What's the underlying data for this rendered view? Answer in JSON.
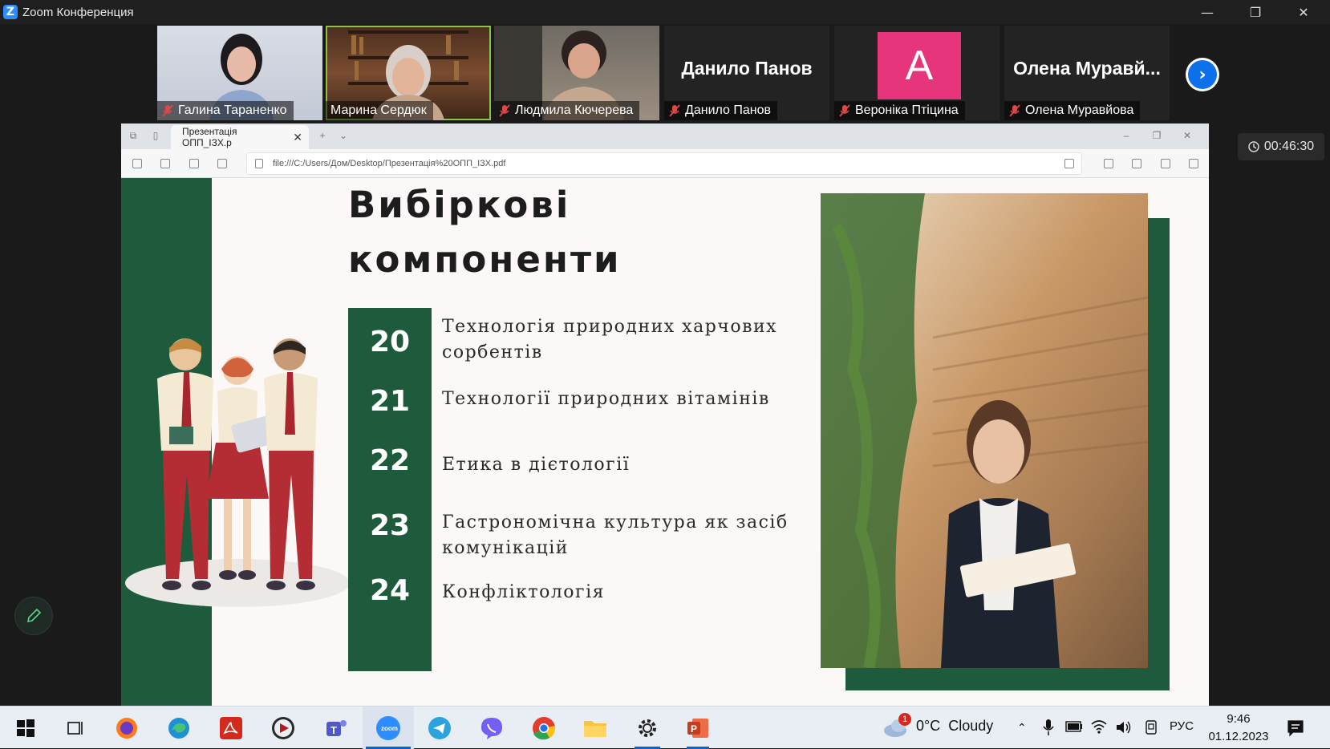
{
  "window": {
    "title": "Zoom Конференция",
    "controls": {
      "minimize": "—",
      "restore": "❐",
      "close": "✕"
    }
  },
  "participants": [
    {
      "name": "Галина Тараненко",
      "muted": true,
      "type": "video"
    },
    {
      "name": "Марина Сердюк",
      "muted": false,
      "type": "video",
      "active_speaker": true
    },
    {
      "name": "Людмила Кючерева",
      "muted": true,
      "type": "video"
    },
    {
      "name": "Данило Панов",
      "muted": true,
      "type": "name",
      "display": "Данило Панов"
    },
    {
      "name": "Вероніка Птіцина",
      "muted": true,
      "type": "avatar",
      "initial": "A",
      "avatar_color": "#e6357a"
    },
    {
      "name": "Олена Муравйова",
      "muted": true,
      "type": "name",
      "display": "Олена  Муравй..."
    }
  ],
  "meeting_timer": "00:46:30",
  "browser": {
    "tab_title": "Презентація ОПП_ІЗХ.p",
    "url": "file:///C:/Users/Дом/Desktop/Презентація%20ОПП_ІЗХ.pdf"
  },
  "slide": {
    "title_line1": "Вибіркові",
    "title_line2": "компоненти",
    "items": [
      {
        "number": "20",
        "text": "Технологія природних харчових сорбентів"
      },
      {
        "number": "21",
        "text": "Технології природних вітамінів"
      },
      {
        "number": "22",
        "text": "Етика в дієтології"
      },
      {
        "number": "23",
        "text": "Гастрономічна культура як засіб комунікацій"
      },
      {
        "number": "24",
        "text": "Конфліктологія"
      }
    ],
    "accent_color": "#1e5b3c"
  },
  "taskbar": {
    "apps": [
      "windows-start",
      "task-view",
      "firefox",
      "edge",
      "acrobat",
      "media-player",
      "teams",
      "zoom",
      "telegram",
      "viber",
      "chrome",
      "file-explorer",
      "settings",
      "powerpoint"
    ],
    "weather": "0°C  Cloudy",
    "weather_badge": "1",
    "language": "РУС",
    "time": "9:46",
    "date": "01.12.2023"
  }
}
